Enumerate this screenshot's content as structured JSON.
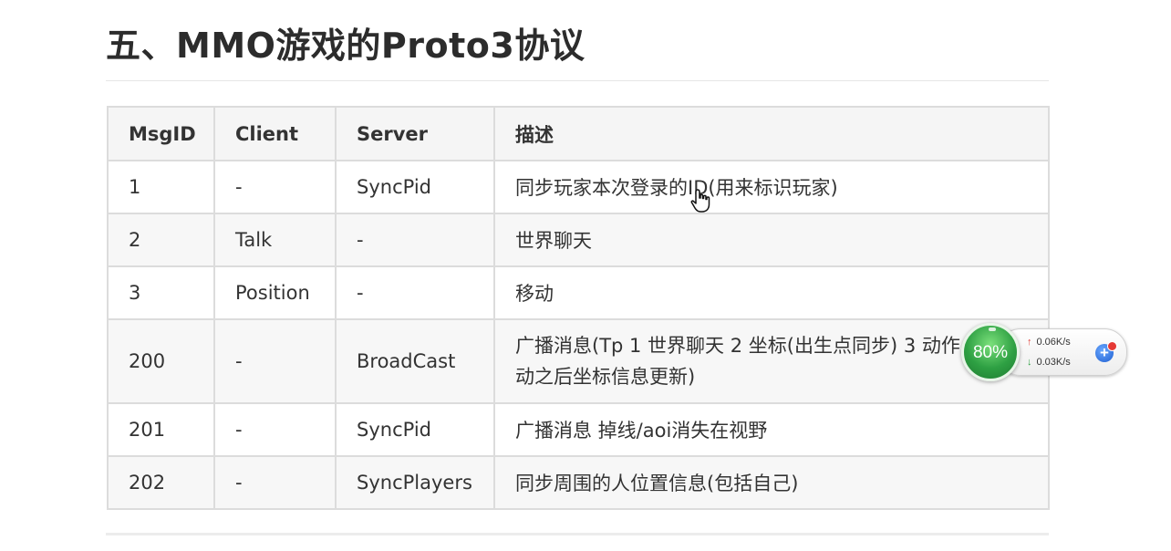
{
  "page": {
    "title": "五、MMO游戏的Proto3协议"
  },
  "table": {
    "headers": [
      "MsgID",
      "Client",
      "Server",
      "描述"
    ],
    "rows": [
      {
        "msgid": "1",
        "client": "-",
        "server": "SyncPid",
        "desc": "同步玩家本次登录的ID(用来标识玩家)"
      },
      {
        "msgid": "2",
        "client": "Talk",
        "server": "-",
        "desc": "世界聊天"
      },
      {
        "msgid": "3",
        "client": "Position",
        "server": "-",
        "desc": "移动"
      },
      {
        "msgid": "200",
        "client": "-",
        "server": "BroadCast",
        "desc": "广播消息(Tp 1 世界聊天 2 坐标(出生点同步) 3 动作",
        "desc2": "动之后坐标信息更新)"
      },
      {
        "msgid": "201",
        "client": "-",
        "server": "SyncPid",
        "desc": "广播消息 掉线/aoi消失在视野"
      },
      {
        "msgid": "202",
        "client": "-",
        "server": "SyncPlayers",
        "desc": "同步周围的人位置信息(包括自己)"
      }
    ]
  },
  "net_widget": {
    "percent": "80%",
    "upload": "0.06K/s",
    "download": "0.03K/s",
    "upload_icon": "↑",
    "download_icon": "↓",
    "plus_icon": "+",
    "ball_color": "#2ea043"
  },
  "cursor": {
    "icon": "hand-pointer-icon"
  }
}
